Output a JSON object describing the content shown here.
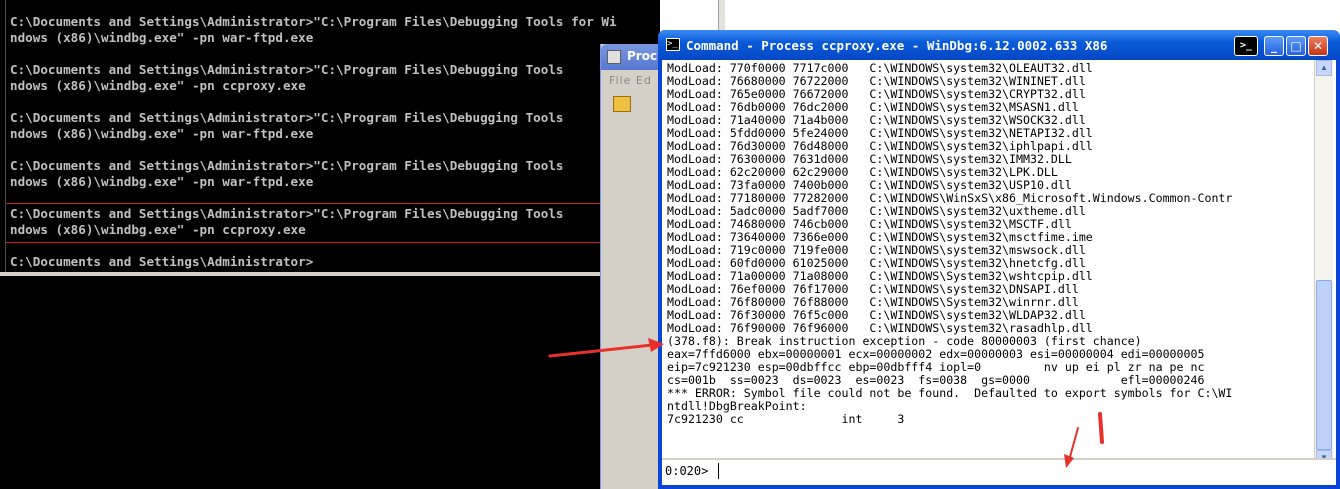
{
  "cmd": {
    "lines": [
      "C:\\Documents and Settings\\Administrator>\"C:\\Program Files\\Debugging Tools for Wi",
      "ndows (x86)\\windbg.exe\" -pn war-ftpd.exe",
      "",
      "C:\\Documents and Settings\\Administrator>\"C:\\Program Files\\Debugging Tools",
      "ndows (x86)\\windbg.exe\" -pn ccproxy.exe",
      "",
      "C:\\Documents and Settings\\Administrator>\"C:\\Program Files\\Debugging Tools",
      "ndows (x86)\\windbg.exe\" -pn war-ftpd.exe",
      "",
      "C:\\Documents and Settings\\Administrator>\"C:\\Program Files\\Debugging Tools",
      "ndows (x86)\\windbg.exe\" -pn war-ftpd.exe",
      "",
      "C:\\Documents and Settings\\Administrator>\"C:\\Program Files\\Debugging Tools",
      "ndows (x86)\\windbg.exe\" -pn ccproxy.exe",
      "",
      "C:\\Documents and Settings\\Administrator>"
    ]
  },
  "behind_window": {
    "title": "Proc",
    "menu": "File Ed"
  },
  "windbg": {
    "title": "Command - Process ccproxy.exe - WinDbg:6.12.0002.633 X86",
    "prompt": "0:020>",
    "input_value": "",
    "output_lines": [
      "ModLoad: 770f0000 7717c000   C:\\WINDOWS\\system32\\OLEAUT32.dll",
      "ModLoad: 76680000 76722000   C:\\WINDOWS\\system32\\WININET.dll",
      "ModLoad: 765e0000 76672000   C:\\WINDOWS\\system32\\CRYPT32.dll",
      "ModLoad: 76db0000 76dc2000   C:\\WINDOWS\\system32\\MSASN1.dll",
      "ModLoad: 71a40000 71a4b000   C:\\WINDOWS\\system32\\WSOCK32.dll",
      "ModLoad: 5fdd0000 5fe24000   C:\\WINDOWS\\system32\\NETAPI32.dll",
      "ModLoad: 76d30000 76d48000   C:\\WINDOWS\\system32\\iphlpapi.dll",
      "ModLoad: 76300000 7631d000   C:\\WINDOWS\\system32\\IMM32.DLL",
      "ModLoad: 62c20000 62c29000   C:\\WINDOWS\\system32\\LPK.DLL",
      "ModLoad: 73fa0000 7400b000   C:\\WINDOWS\\system32\\USP10.dll",
      "ModLoad: 77180000 77282000   C:\\WINDOWS\\WinSxS\\x86_Microsoft.Windows.Common-Contr",
      "ModLoad: 5adc0000 5adf7000   C:\\WINDOWS\\system32\\uxtheme.dll",
      "ModLoad: 74680000 746cb000   C:\\WINDOWS\\system32\\MSCTF.dll",
      "ModLoad: 73640000 7366e000   C:\\WINDOWS\\system32\\msctfime.ime",
      "ModLoad: 719c0000 719fe000   C:\\WINDOWS\\system32\\mswsock.dll",
      "ModLoad: 60fd0000 61025000   C:\\WINDOWS\\system32\\hnetcfg.dll",
      "ModLoad: 71a00000 71a08000   C:\\WINDOWS\\System32\\wshtcpip.dll",
      "ModLoad: 76ef0000 76f17000   C:\\WINDOWS\\system32\\DNSAPI.dll",
      "ModLoad: 76f80000 76f88000   C:\\WINDOWS\\System32\\winrnr.dll",
      "ModLoad: 76f30000 76f5c000   C:\\WINDOWS\\system32\\WLDAP32.dll",
      "ModLoad: 76f90000 76f96000   C:\\WINDOWS\\system32\\rasadhlp.dll",
      "(378.f8): Break instruction exception - code 80000003 (first chance)",
      "eax=7ffd6000 ebx=00000001 ecx=00000002 edx=00000003 esi=00000004 edi=00000005",
      "eip=7c921230 esp=00dbffcc ebp=00dbfff4 iopl=0         nv up ei pl zr na pe nc",
      "cs=001b  ss=0023  ds=0023  es=0023  fs=0038  gs=0000             efl=00000246",
      "*** ERROR: Symbol file could not be found.  Defaulted to export symbols for C:\\WI",
      "ntdll!DbgBreakPoint:",
      "7c921230 cc              int     3"
    ]
  },
  "colors": {
    "annotation_red": "#e8302a",
    "xp_blue": "#0a5bd8"
  }
}
